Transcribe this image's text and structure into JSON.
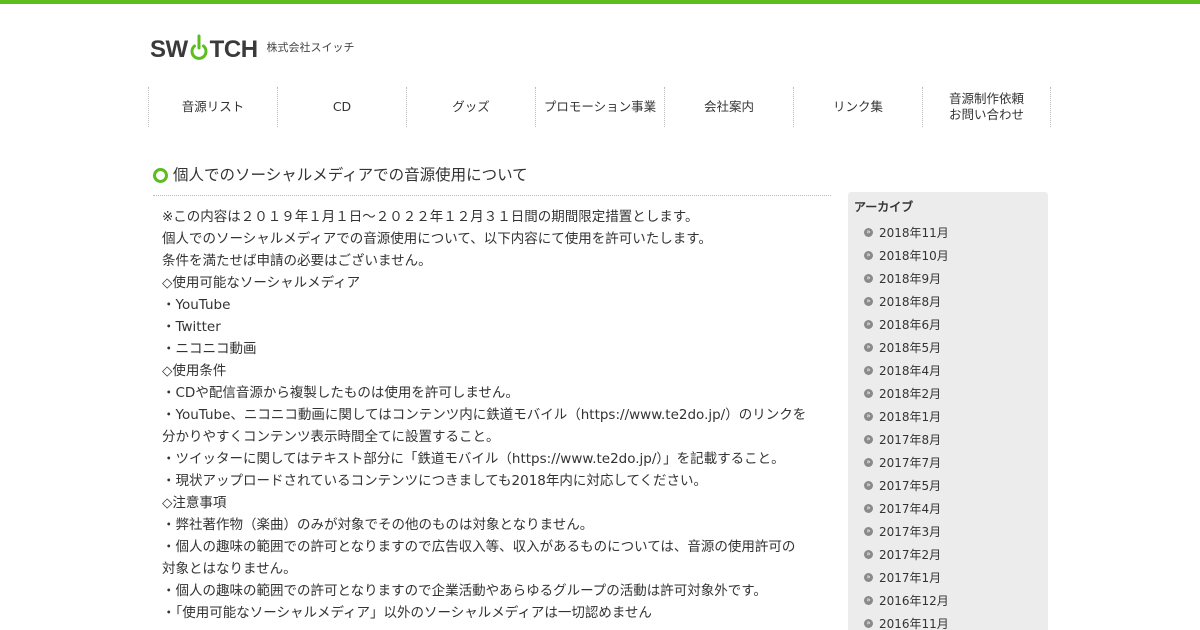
{
  "header": {
    "logo_letters": [
      "S",
      "W",
      "T",
      "C",
      "H"
    ],
    "company_name": "株式会社スイッチ",
    "accent_color": "#5bbd1e"
  },
  "nav": {
    "items": [
      {
        "label": "音源リスト"
      },
      {
        "label": "CD"
      },
      {
        "label": "グッズ"
      },
      {
        "label": "プロモーション事業"
      },
      {
        "label": "会社案内"
      },
      {
        "label": "リンク集"
      },
      {
        "label": "音源制作依頼\nお問い合わせ"
      }
    ]
  },
  "article": {
    "title": "個人でのソーシャルメディアでの音源使用について",
    "lines": [
      "※この内容は２０１９年１月１日～２０２２年１２月３１日間の期間限定措置とします。",
      "個人でのソーシャルメディアでの音源使用について、以下内容にて使用を許可いたします。",
      "条件を満たせば申請の必要はございません。",
      "◇使用可能なソーシャルメディア",
      "・YouTube",
      "・Twitter",
      "・ニコニコ動画",
      "◇使用条件",
      "・CDや配信音源から複製したものは使用を許可しません。",
      "・YouTube、ニコニコ動画に関してはコンテンツ内に鉄道モバイル（https://www.te2do.jp/）のリンクを",
      "分かりやすくコンテンツ表示時間全てに設置すること。",
      "・ツイッターに関してはテキスト部分に「鉄道モバイル（https://www.te2do.jp/）」を記載すること。",
      "・現状アップロードされているコンテンツにつきましても2018年内に対応してください。",
      "◇注意事項",
      "・弊社著作物（楽曲）のみが対象でその他のものは対象となりません。",
      "・個人の趣味の範囲での許可となりますので広告収入等、収入があるものについては、音源の使用許可の",
      "対象とはなりません。",
      "・個人の趣味の範囲での許可となりますので企業活動やあらゆるグループの活動は許可対象外です。",
      "・「使用可能なソーシャルメディア」以外のソーシャルメディアは一切認めません"
    ]
  },
  "sidebar": {
    "heading": "アーカイブ",
    "archives": [
      "2018年11月",
      "2018年10月",
      "2018年9月",
      "2018年8月",
      "2018年6月",
      "2018年5月",
      "2018年4月",
      "2018年2月",
      "2018年1月",
      "2017年8月",
      "2017年7月",
      "2017年5月",
      "2017年4月",
      "2017年3月",
      "2017年2月",
      "2017年1月",
      "2016年12月",
      "2016年11月"
    ]
  }
}
